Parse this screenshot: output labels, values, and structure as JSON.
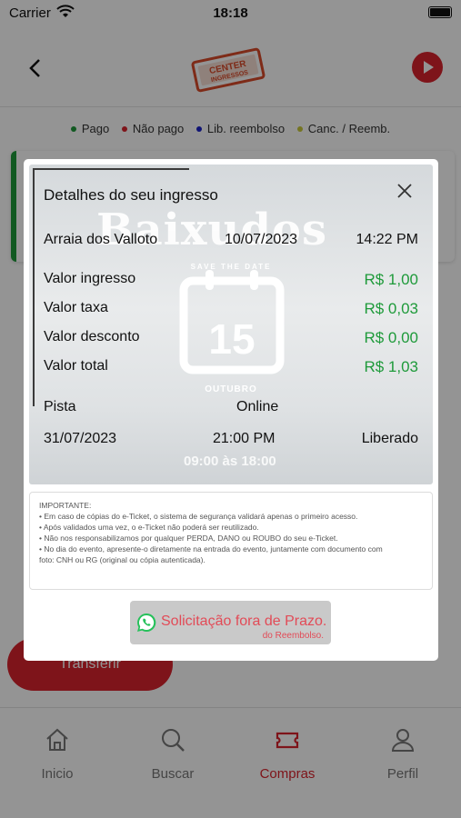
{
  "status_bar": {
    "carrier": "Carrier",
    "time": "18:18"
  },
  "header": {
    "logo_line1": "CENTER",
    "logo_line2": "INGRESSOS"
  },
  "legend": [
    {
      "label": "Pago",
      "color": "#1e9a3a"
    },
    {
      "label": "Não pago",
      "color": "#d9232d"
    },
    {
      "label": "Lib. reembolso",
      "color": "#1a22c8"
    },
    {
      "label": "Canc. / Reemb.",
      "color": "#c9c93a"
    }
  ],
  "transfer_button": "Transferir",
  "tabs": [
    {
      "label": "Inicio",
      "icon": "home-icon"
    },
    {
      "label": "Buscar",
      "icon": "search-icon"
    },
    {
      "label": "Compras",
      "icon": "ticket-icon",
      "active": true
    },
    {
      "label": "Perfil",
      "icon": "user-icon"
    }
  ],
  "modal": {
    "title": "Detalhes do seu ingresso",
    "flyer": {
      "brand": "Baixudos",
      "save_the_date": "SAVE THE DATE",
      "day": "15",
      "month": "OUTUBRO",
      "hours": "09:00 às 18:00"
    },
    "event": {
      "name": "Arraia dos Valloto",
      "date": "10/07/2023",
      "time": "14:22 PM"
    },
    "values": {
      "ingresso_label": "Valor ingresso",
      "ingresso": "R$ 1,00",
      "taxa_label": "Valor taxa",
      "taxa": "R$ 0,03",
      "desconto_label": "Valor desconto",
      "desconto": "R$ 0,00",
      "total_label": "Valor total",
      "total": "R$ 1,03"
    },
    "sector": {
      "name": "Pista",
      "type": "Online"
    },
    "usage": {
      "date": "31/07/2023",
      "time": "21:00 PM",
      "status": "Liberado"
    },
    "important": [
      "IMPORTANTE:",
      "• Em caso de cópias do e-Ticket, o sistema de segurança validará apenas o primeiro acesso.",
      "• Após validados uma vez, o e-Ticket não poderá ser reutilizado.",
      "• Não nos responsabilizamos por qualquer PERDA, DANO ou ROUBO do seu e-Ticket.",
      "• No dia do evento, apresente-o diretamente na entrada do evento, juntamente com documento com",
      "foto: CNH ou RG (original ou cópia autenticada)."
    ],
    "whatsapp_button": {
      "label": "Solicitação fora de Prazo.",
      "sub": "do Reembolso."
    }
  }
}
